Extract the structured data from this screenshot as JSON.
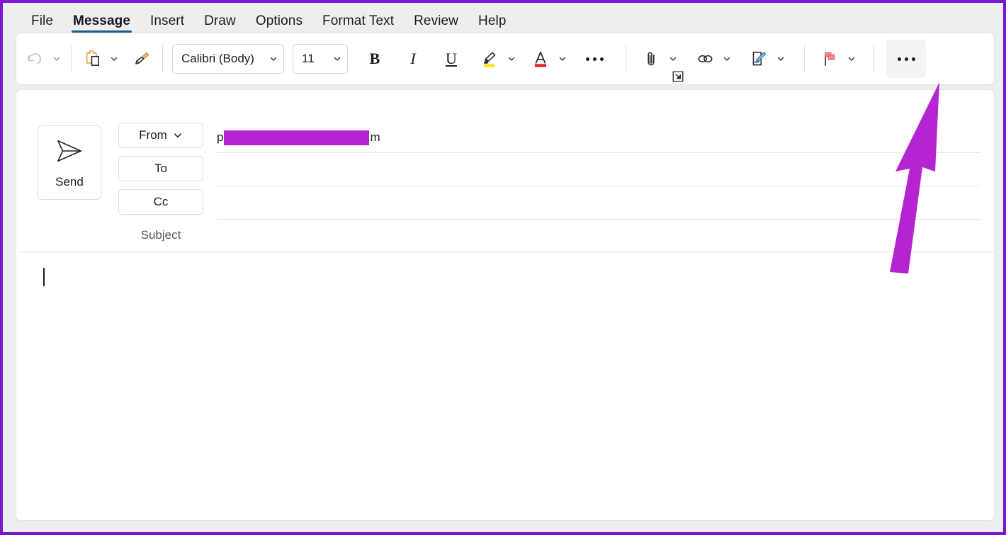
{
  "window": {
    "app": "Outlook Message Compose",
    "frame_color": "#7719d1"
  },
  "tabs": {
    "items": [
      {
        "label": "File",
        "active": false
      },
      {
        "label": "Message",
        "active": true
      },
      {
        "label": "Insert",
        "active": false
      },
      {
        "label": "Draw",
        "active": false
      },
      {
        "label": "Options",
        "active": false
      },
      {
        "label": "Format Text",
        "active": false
      },
      {
        "label": "Review",
        "active": false
      },
      {
        "label": "Help",
        "active": false
      }
    ],
    "active_underline_color": "#1a5e8a"
  },
  "ribbon": {
    "undo": {
      "name": "undo-button",
      "tooltip": "Undo",
      "state": "disabled"
    },
    "undo_more": {
      "tooltip": "Undo options"
    },
    "paste": {
      "name": "paste-button",
      "tooltip": "Paste",
      "accent": "#e8a33d"
    },
    "paste_more": {
      "tooltip": "Paste options"
    },
    "format_painter": {
      "name": "format-painter-button",
      "tooltip": "Format Painter",
      "accent": "#e8a33d"
    },
    "font_name": {
      "value": "Calibri (Body)",
      "tooltip": "Font"
    },
    "font_size": {
      "value": "11",
      "tooltip": "Font Size"
    },
    "bold": {
      "label": "B",
      "tooltip": "Bold"
    },
    "italic": {
      "label": "I",
      "tooltip": "Italic"
    },
    "underline": {
      "label": "U",
      "tooltip": "Underline"
    },
    "highlight": {
      "tooltip": "Text Highlight Color",
      "color": "#ffe800"
    },
    "highlight_more": {
      "tooltip": "Highlight color options"
    },
    "font_color": {
      "label": "A",
      "tooltip": "Font Color",
      "color": "#e01b1b"
    },
    "font_color_more": {
      "tooltip": "Font color options"
    },
    "font_overflow": {
      "tooltip": "More font options"
    },
    "dialog_launcher": {
      "tooltip": "Font dialog box launcher"
    },
    "attach": {
      "tooltip": "Attach File"
    },
    "attach_more": {
      "tooltip": "Attach file options"
    },
    "link": {
      "tooltip": "Link"
    },
    "link_more": {
      "tooltip": "Link options"
    },
    "signature": {
      "tooltip": "Signature",
      "accent": "#3a8fd1"
    },
    "signature_more": {
      "tooltip": "Signature options"
    },
    "flag": {
      "tooltip": "Follow Up",
      "color": "#f07a7a"
    },
    "flag_more": {
      "tooltip": "Follow up options"
    },
    "more_options": {
      "tooltip": "More options",
      "state": "highlighted"
    },
    "collapse": {
      "tooltip": "Ribbon display options"
    }
  },
  "compose": {
    "send": {
      "label": "Send",
      "icon": "send-plane-icon"
    },
    "fields": [
      {
        "key": "from",
        "label": "From",
        "has_dropdown": true,
        "bordered": true,
        "value_prefix": "p",
        "value_redacted": true,
        "value_suffix": "m"
      },
      {
        "key": "to",
        "label": "To",
        "has_dropdown": false,
        "bordered": true,
        "value_prefix": "",
        "value_redacted": false,
        "value_suffix": ""
      },
      {
        "key": "cc",
        "label": "Cc",
        "has_dropdown": false,
        "bordered": true,
        "value_prefix": "",
        "value_redacted": false,
        "value_suffix": ""
      },
      {
        "key": "subject",
        "label": "Subject",
        "has_dropdown": false,
        "bordered": false,
        "value_prefix": "",
        "value_redacted": false,
        "value_suffix": ""
      }
    ],
    "body": {
      "text": "",
      "caret_visible": true
    }
  },
  "annotation": {
    "arrow": {
      "color": "#b524d1",
      "points_to": "more-options-button"
    }
  }
}
